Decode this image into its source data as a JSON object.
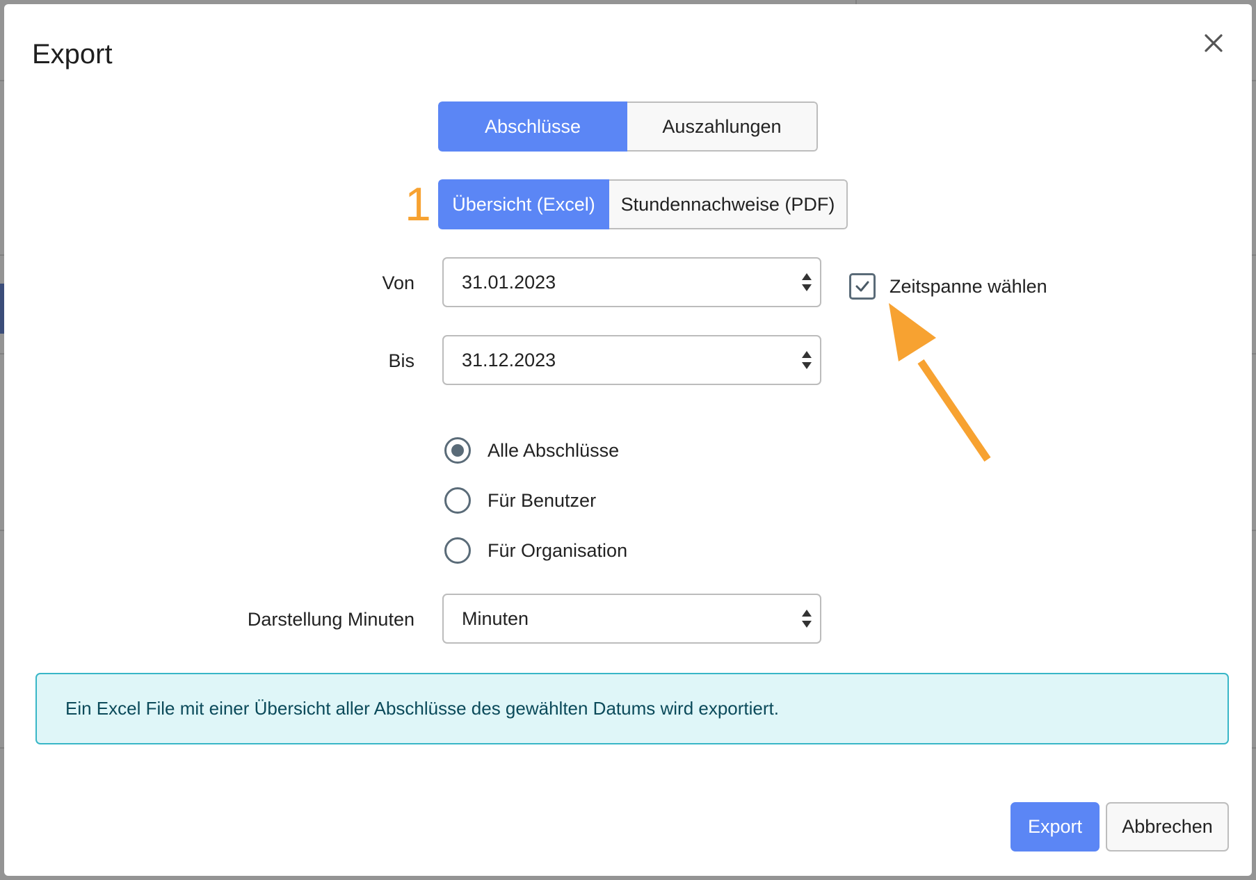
{
  "dialog": {
    "title": "Export",
    "close_icon": "close-icon"
  },
  "export_type_tabs": [
    {
      "label": "Abschlüsse",
      "active": true
    },
    {
      "label": "Auszahlungen",
      "active": false
    }
  ],
  "format_tabs": [
    {
      "label": "Übersicht (Excel)",
      "active": true
    },
    {
      "label": "Stundennachweise (PDF)",
      "active": false
    }
  ],
  "annotation": {
    "step_number": "1",
    "color": "#f7a231"
  },
  "form": {
    "von_label": "Von",
    "von_value": "31.01.2023",
    "bis_label": "Bis",
    "bis_value": "31.12.2023",
    "range_checkbox_label": "Zeitspanne wählen",
    "range_checkbox_checked": true,
    "radio_options": [
      {
        "label": "Alle Abschlüsse",
        "selected": true
      },
      {
        "label": "Für Benutzer",
        "selected": false
      },
      {
        "label": "Für Organisation",
        "selected": false
      }
    ],
    "minutes_label": "Darstellung Minuten",
    "minutes_value": "Minuten"
  },
  "info_message": "Ein Excel File mit einer Übersicht aller Abschlüsse des gewählten Datums wird exportiert.",
  "footer": {
    "export_label": "Export",
    "cancel_label": "Abbrechen"
  },
  "colors": {
    "accent": "#5b86f5",
    "info_bg": "#dff6f8",
    "info_border": "#38b6c7",
    "annotation": "#f7a231"
  }
}
